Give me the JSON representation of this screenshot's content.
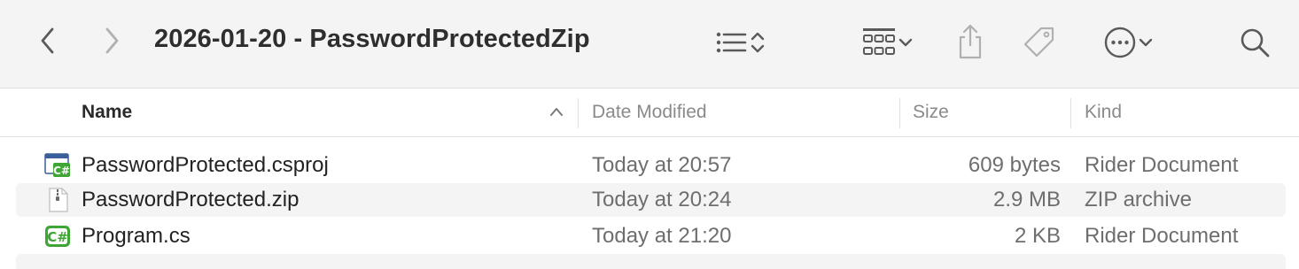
{
  "window": {
    "title": "2026-01-20 - PasswordProtectedZip"
  },
  "toolbar": {
    "back_icon": "chevron-left-icon",
    "forward_icon": "chevron-right-icon",
    "view_icon": "list-view-icon",
    "group_icon": "grid-group-icon",
    "share_icon": "share-icon",
    "tag_icon": "tag-icon",
    "more_icon": "ellipsis-circle-icon",
    "search_icon": "magnifier-icon"
  },
  "columns": {
    "name": "Name",
    "date": "Date Modified",
    "size": "Size",
    "kind": "Kind"
  },
  "files": [
    {
      "name": "PasswordProtected.csproj",
      "date": "Today at 20:57",
      "size": "609 bytes",
      "kind": "Rider Document",
      "icon": "csproj-file-icon"
    },
    {
      "name": "PasswordProtected.zip",
      "date": "Today at 20:24",
      "size": "2.9 MB",
      "kind": "ZIP archive",
      "icon": "zip-file-icon"
    },
    {
      "name": "Program.cs",
      "date": "Today at 21:20",
      "size": "2 KB",
      "kind": "Rider Document",
      "icon": "csharp-file-icon"
    }
  ],
  "colors": {
    "toolbar_bg": "#f4f4f4",
    "alt_row_bg": "#f4f4f4",
    "icon_gray": "#6a6a6a",
    "csharp_green": "#3fa535"
  }
}
